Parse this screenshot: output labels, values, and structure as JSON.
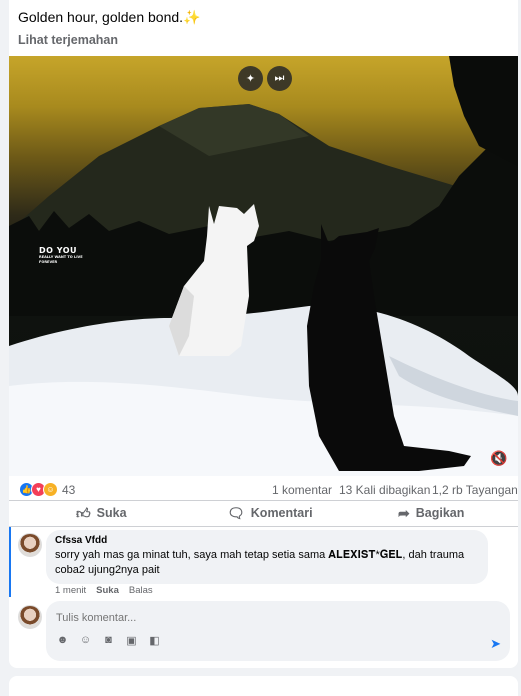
{
  "post": {
    "caption": "Golden hour, golden bond.",
    "caption_emoji": "✨",
    "translate_label": "Lihat terjemahan"
  },
  "video": {
    "overlay_title": "DO YOU",
    "overlay_sub": "REALLY WANT TO LIVE",
    "overlay_sub2": "FOREVER"
  },
  "stats": {
    "reaction_count": "43",
    "comments": "1 komentar",
    "shares": "13 Kali dibagikan",
    "views": "1,2 rb Tayangan"
  },
  "actions": {
    "like": "Suka",
    "comment": "Komentari",
    "share": "Bagikan"
  },
  "comment": {
    "author": "Cfssa Vfdd",
    "text": "sorry yah mas ga minat tuh, saya mah tetap setia sama 𝐀𝐋𝐄𝐗𝐈𝐒𝐓*𝐆𝐄𝐋, dah trauma coba2 ujung2nya pait",
    "time": "1 menit",
    "like": "Suka",
    "reply": "Balas"
  },
  "composer": {
    "placeholder": "Tulis komentar..."
  },
  "colors": {
    "accent": "#1877f2",
    "secondary_text": "#65676b"
  }
}
